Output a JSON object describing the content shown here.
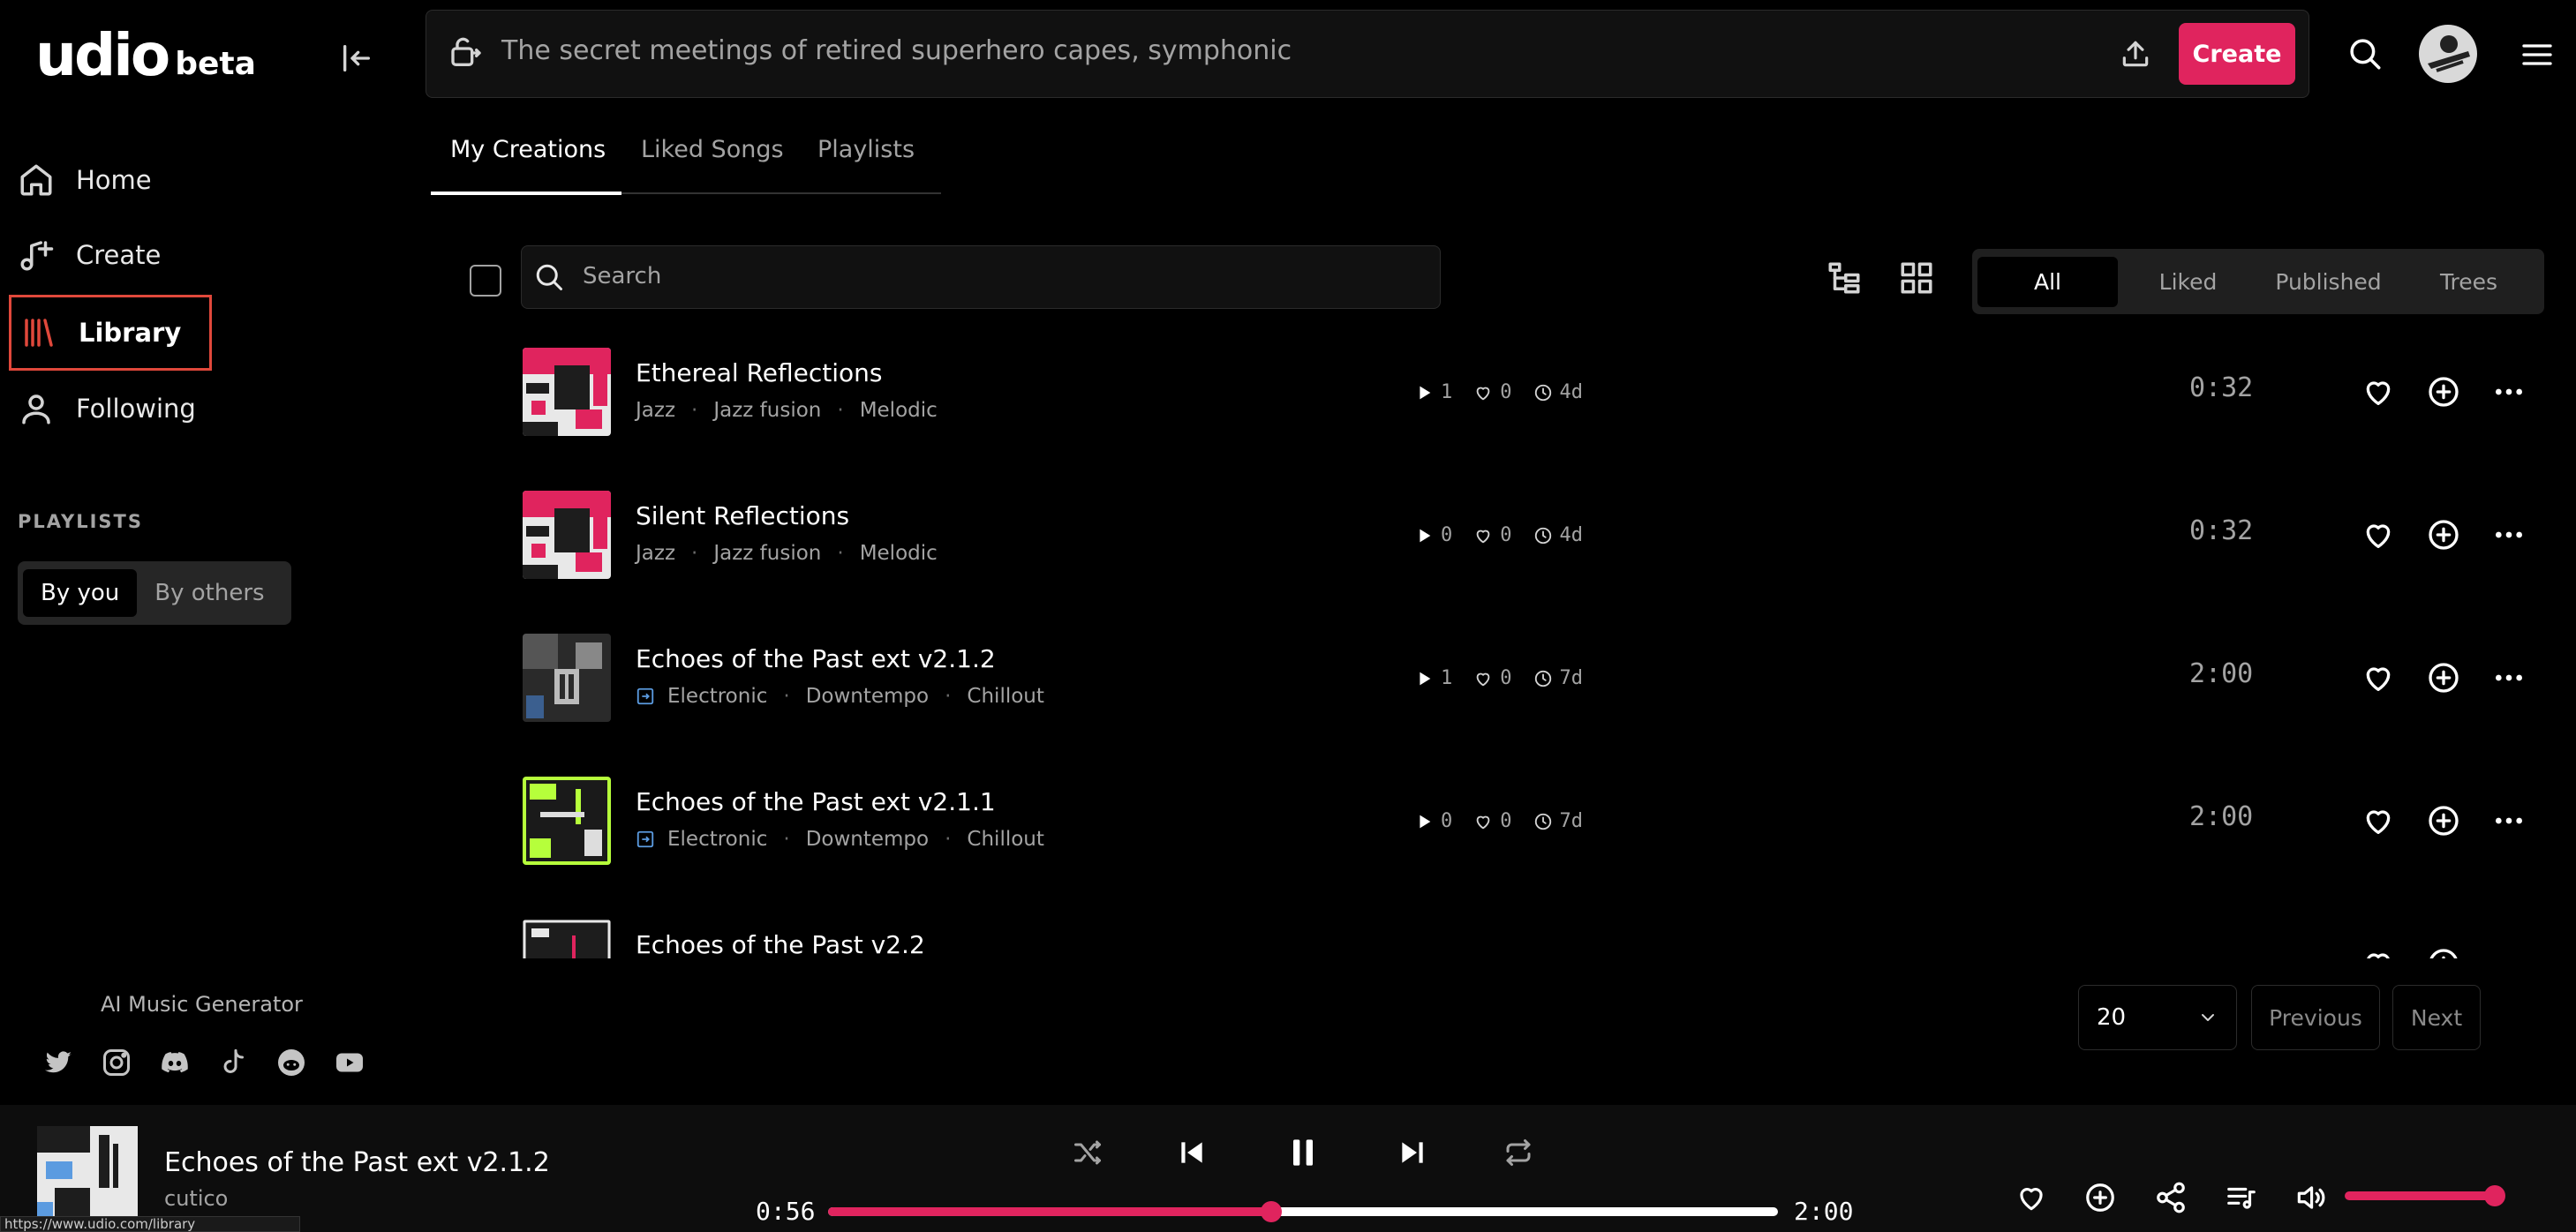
{
  "app": {
    "logo_text": "udio",
    "logo_badge": "beta",
    "accent_color": "#e0245e",
    "highlight_color": "#e0483b"
  },
  "sidebar": {
    "items": [
      {
        "label": "Home",
        "icon": "home-icon"
      },
      {
        "label": "Create",
        "icon": "music-plus-icon"
      },
      {
        "label": "Library",
        "icon": "library-icon",
        "active": true
      },
      {
        "label": "Following",
        "icon": "user-icon"
      }
    ],
    "playlists_heading": "PLAYLISTS",
    "playlist_filter": {
      "options": [
        "By you",
        "By others"
      ],
      "selected": "By you"
    },
    "footer_label": "AI Music Generator",
    "socials": [
      "twitter-icon",
      "instagram-icon",
      "discord-icon",
      "tiktok-icon",
      "reddit-icon",
      "youtube-icon"
    ]
  },
  "topbar": {
    "prompt_text": "The secret meetings of retired superhero capes,  symphonic",
    "create_label": "Create"
  },
  "tabs": {
    "items": [
      "My Creations",
      "Liked Songs",
      "Playlists"
    ],
    "active": "My Creations"
  },
  "toolbar": {
    "search_placeholder": "Search",
    "filters": [
      "All",
      "Liked",
      "Published",
      "Trees"
    ],
    "active_filter": "All"
  },
  "songs": [
    {
      "title": "Ethereal Reflections",
      "tags": [
        "Jazz",
        "Jazz fusion",
        "Melodic"
      ],
      "extension": false,
      "plays": "1",
      "likes": "0",
      "age": "4d",
      "duration": "0:32",
      "art": "pink"
    },
    {
      "title": "Silent Reflections",
      "tags": [
        "Jazz",
        "Jazz fusion",
        "Melodic"
      ],
      "extension": false,
      "plays": "0",
      "likes": "0",
      "age": "4d",
      "duration": "0:32",
      "art": "pink"
    },
    {
      "title": "Echoes of the Past ext v2.1.2",
      "tags": [
        "Electronic",
        "Downtempo",
        "Chillout"
      ],
      "extension": true,
      "plays": "1",
      "likes": "0",
      "age": "7d",
      "duration": "2:00",
      "art": "gray"
    },
    {
      "title": "Echoes of the Past ext v2.1.1",
      "tags": [
        "Electronic",
        "Downtempo",
        "Chillout"
      ],
      "extension": true,
      "plays": "0",
      "likes": "0",
      "age": "7d",
      "duration": "2:00",
      "art": "lime"
    },
    {
      "title": "Echoes of the Past v2.2",
      "tags": [],
      "extension": false,
      "plays": "",
      "likes": "",
      "age": "",
      "duration": "",
      "art": "dark"
    }
  ],
  "pagination": {
    "page_size": "20",
    "previous_label": "Previous",
    "next_label": "Next"
  },
  "player": {
    "title": "Echoes of the Past ext v2.1.2",
    "artist": "cutico",
    "current_time": "0:56",
    "total_time": "2:00",
    "progress": 0.467,
    "volume": 1.0
  },
  "status_bar_url": "https://www.udio.com/library"
}
